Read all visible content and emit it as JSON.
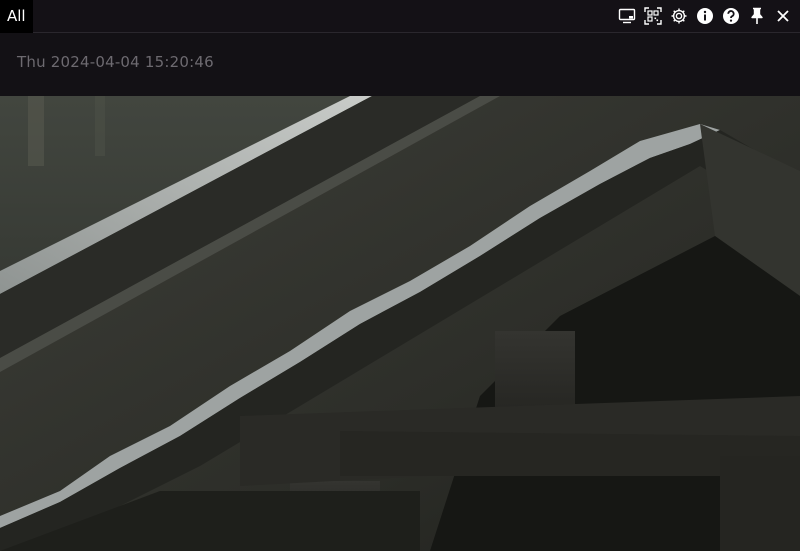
{
  "topbar": {
    "tab_label": "All"
  },
  "toolbar": {
    "icons": [
      "monitor-icon",
      "qr-scan-icon",
      "gear-icon",
      "info-icon",
      "help-icon",
      "pin-icon",
      "close-icon"
    ]
  },
  "datebar": {
    "datetime": "Thu 2024-04-04 15:20:46"
  },
  "colors": {
    "background": "#131115",
    "tab_active": "#000000",
    "date_text": "#6d6a70",
    "icon": "#ffffff"
  }
}
